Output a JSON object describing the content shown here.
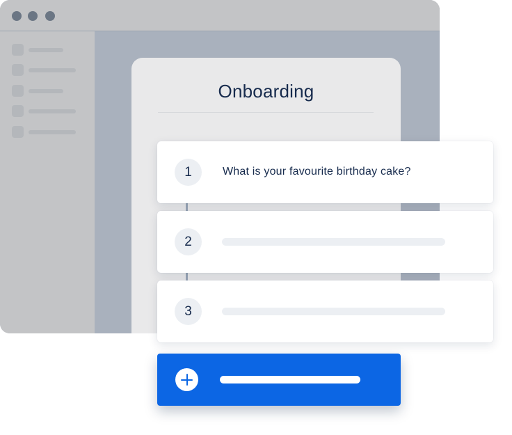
{
  "window": {
    "controls": [
      "window-dot",
      "window-dot",
      "window-dot"
    ]
  },
  "sidebar": {
    "rows": 5
  },
  "panel": {
    "title": "Onboarding"
  },
  "steps": [
    {
      "number": "1",
      "text": "What is your favourite birthday cake?"
    },
    {
      "number": "2",
      "text": ""
    },
    {
      "number": "3",
      "text": ""
    }
  ],
  "add_button": {
    "icon": "plus-circle-icon"
  },
  "colors": {
    "accent": "#0c66e4",
    "text": "#172b4d",
    "window_bg": "#a9b1bd",
    "chrome": "#c3c4c6"
  }
}
